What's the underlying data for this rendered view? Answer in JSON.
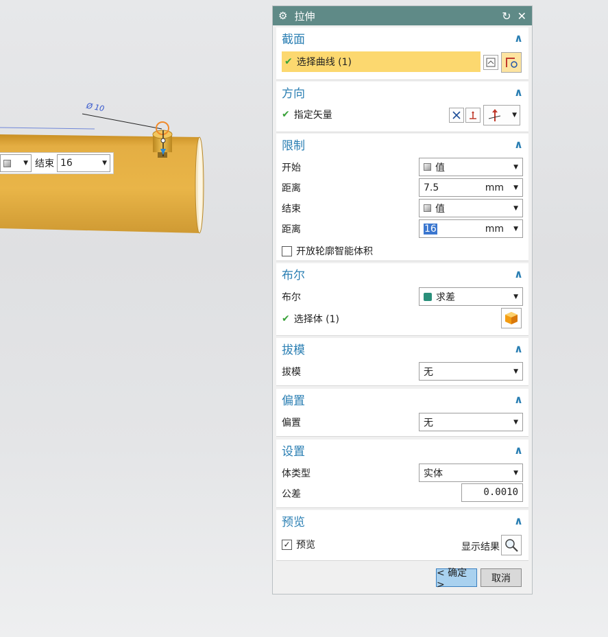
{
  "viewport": {
    "dimension_label": "Ø 10",
    "float_bar": {
      "end_label": "结束",
      "end_value": "16"
    }
  },
  "dialog": {
    "title": "拉伸",
    "sections": {
      "section": {
        "title": "截面",
        "select_curve": "选择曲线 (1)"
      },
      "direction": {
        "title": "方向",
        "specify_vector": "指定矢量"
      },
      "limits": {
        "title": "限制",
        "start_label": "开始",
        "start_value": "值",
        "distance1_label": "距离",
        "distance1_value": "7.5",
        "distance1_unit": "mm",
        "end_label": "结束",
        "end_value": "值",
        "distance2_label": "距离",
        "distance2_value": "16",
        "distance2_unit": "mm",
        "open_profile": "开放轮廓智能体积"
      },
      "boolean": {
        "title": "布尔",
        "label": "布尔",
        "value": "求差",
        "select_body": "选择体 (1)"
      },
      "draft": {
        "title": "拔模",
        "label": "拔模",
        "value": "无"
      },
      "offset": {
        "title": "偏置",
        "label": "偏置",
        "value": "无"
      },
      "settings": {
        "title": "设置",
        "body_type_label": "体类型",
        "body_type_value": "实体",
        "tolerance_label": "公差",
        "tolerance_value": "0.0010"
      },
      "preview": {
        "title": "预览",
        "preview_label": "预览",
        "show_result": "显示结果"
      }
    },
    "buttons": {
      "ok": "< 确定 >",
      "cancel": "取消"
    }
  },
  "colors": {
    "title_bar": "#5f8a87",
    "section_title": "#2b7fb3",
    "highlight": "#fcd86f",
    "cylinder": "#e3ad3e"
  }
}
